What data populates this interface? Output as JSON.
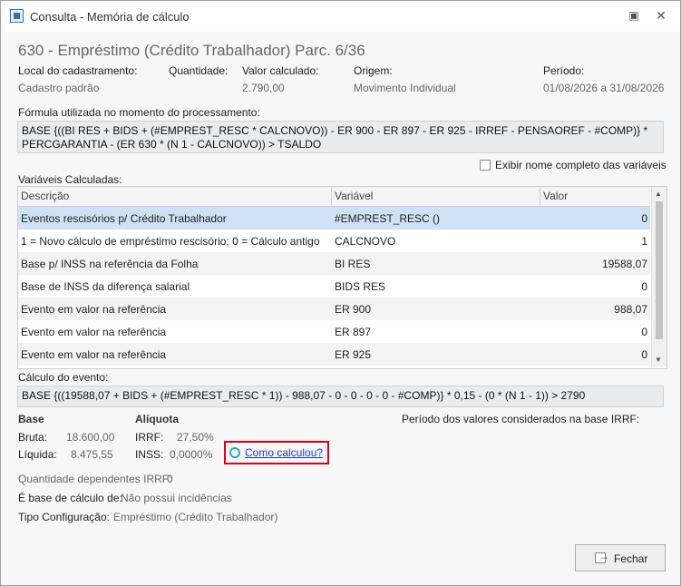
{
  "window": {
    "title": "Consulta - Memória de cálculo"
  },
  "header": {
    "title": "630 - Empréstimo (Crédito Trabalhador) Parc. 6/36"
  },
  "info": {
    "local_label": "Local do cadastramento:",
    "local_value": "Cadastro padrão",
    "quantidade_label": "Quantidade:",
    "quantidade_value": "",
    "valor_label": "Valor calculado:",
    "valor_value": "2.790,00",
    "origem_label": "Origem:",
    "origem_value": "Movimento Individual",
    "periodo_label": "Período:",
    "periodo_value": "01/08/2026 a 31/08/2026"
  },
  "formula": {
    "label": "Fórmula utilizada no momento do processamento:",
    "line1": "BASE {((BI RES + BIDS + (#EMPREST_RESC * CALCNOVO)) - ER 900 - ER 897 - ER 925 - IRREF - PENSAOREF - #COMP)} *",
    "line2": "PERCGARANTIA - (ER 630 * (N 1 - CALCNOVO)) > TSALDO"
  },
  "variables": {
    "label": "Variáveis Calculadas:",
    "show_full_names_label": "Exibir nome completo das variáveis",
    "columns": [
      "Descrição",
      "Variável",
      "Valor"
    ],
    "rows": [
      {
        "descricao": "Eventos rescisórios p/ Crédito Trabalhador",
        "variavel": "#EMPREST_RESC ()",
        "valor": "0"
      },
      {
        "descricao": "1 = Novo cálculo de empréstimo rescisório; 0 = Cálculo antigo",
        "variavel": "CALCNOVO",
        "valor": "1"
      },
      {
        "descricao": "Base p/ INSS na referência da Folha",
        "variavel": "BI RES",
        "valor": "19588,07"
      },
      {
        "descricao": "Base de INSS da diferença salarial",
        "variavel": "BIDS RES",
        "valor": "0"
      },
      {
        "descricao": "Evento em valor na referência",
        "variavel": "ER 900",
        "valor": "988,07"
      },
      {
        "descricao": "Evento em valor na referência",
        "variavel": "ER 897",
        "valor": "0"
      },
      {
        "descricao": "Evento em valor na referência",
        "variavel": "ER 925",
        "valor": "0"
      }
    ]
  },
  "evento": {
    "label": "Cálculo do evento:",
    "text": "BASE {((19588,07 + BIDS + (#EMPREST_RESC * 1)) - 988,07 - 0 - 0 - 0 - 0 - #COMP)} * 0,15 - (0 * (N 1 - 1)) > 2790"
  },
  "base": {
    "title": "Base",
    "bruta_label": "Bruta:",
    "bruta_value": "18.600,00",
    "liquida_label": "Líquida:",
    "liquida_value": "8.475,55"
  },
  "aliquota": {
    "title": "Alíquota",
    "irrf_label": "IRRF:",
    "irrf_value": "27,50%",
    "inss_label": "INSS:",
    "inss_value": "0,0000%"
  },
  "periodo_irrf_label": "Período dos valores considerados na base IRRF:",
  "como_calculou": "Como calculou?",
  "footer": {
    "dependentes_label": "Quantidade dependentes IRRF:",
    "dependentes_value": "0",
    "base_calculo_label": "É base de cálculo de:",
    "base_calculo_value": "Não possui incidências",
    "tipo_label": "Tipo Configuração:",
    "tipo_value": "Empréstimo (Crédito Trabalhador)"
  },
  "buttons": {
    "fechar": "Fechar"
  },
  "icons": {
    "app": "app-icon",
    "restore": "restore-icon",
    "close": "close-icon",
    "help": "help-circle-icon",
    "exit": "exit-icon"
  },
  "colors": {
    "selected_row": "#cfe2f5",
    "link": "#1a3ec8",
    "highlight_border": "#d9001b"
  }
}
